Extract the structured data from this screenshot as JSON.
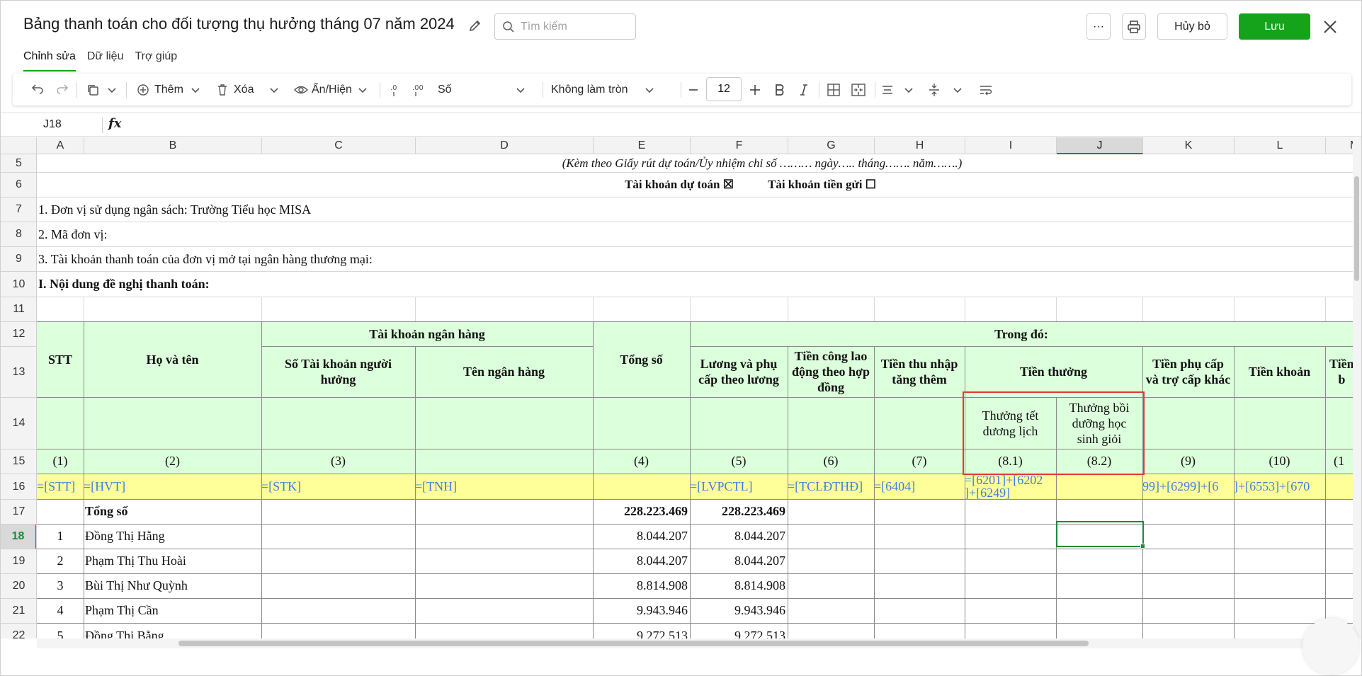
{
  "header": {
    "title": "Bảng thanh toán cho đối tượng thụ hưởng tháng 07 năm 2024",
    "search_placeholder": "Tìm kiếm",
    "more_label": "···",
    "cancel_label": "Hủy bỏ",
    "save_label": "Lưu"
  },
  "colors": {
    "accent": "#15a31c",
    "header_fill": "#dcffdc",
    "formula_row": "#ffff99",
    "formula_text": "#3f7fe0",
    "highlight": "#e53935"
  },
  "menu_tabs": [
    {
      "label": "Chỉnh sửa",
      "active": true
    },
    {
      "label": "Dữ liệu",
      "active": false
    },
    {
      "label": "Trợ giúp",
      "active": false
    }
  ],
  "toolbar": {
    "insert_label": "Thêm",
    "delete_label": "Xóa",
    "show_hide_label": "Ẩn/Hiện",
    "format_label": "Số",
    "rounding_label": "Không làm tròn",
    "font_size": "12"
  },
  "formula_bar": {
    "cell_ref": "J18",
    "fx": "fx"
  },
  "columns": [
    "A",
    "B",
    "C",
    "D",
    "E",
    "F",
    "G",
    "H",
    "I",
    "J",
    "K",
    "L",
    "M"
  ],
  "selected_column": "J",
  "rows": [
    "5",
    "6",
    "7",
    "8",
    "9",
    "10",
    "11",
    "12",
    "13",
    "14",
    "15",
    "16",
    "17",
    "18",
    "19",
    "20",
    "21",
    "22"
  ],
  "selected_row": "18",
  "sheet": {
    "r5": "(Kèm theo Giấy rút dự toán/Ủy nhiệm chi số ……… ngày….. tháng……. năm…….)",
    "r6a": "Tài khoản dự toán ☒",
    "r6b": "Tài khoản tiền gửi ☐",
    "r7": "1. Đơn vị sử dụng ngân sách: Trường Tiểu học MISA",
    "r8": "2. Mã đơn vị:",
    "r9": "3. Tài khoản thanh toán của đơn vị mở tại ngân hàng thương mại:",
    "r10": "I. Nội dung đề nghị thanh toán:",
    "hdr": {
      "stt": "STT",
      "ho_ten": "Họ và tên",
      "tk_ngan_hang": "Tài khoản ngân hàng",
      "so_tk": "Số Tài khoản người hưởng",
      "ten_ngan_hang": "Tên ngân hàng",
      "tong_so": "Tổng số",
      "trong_do": "Trong đó:",
      "luong": "Lương và phụ cấp theo lương",
      "tien_cong": "Tiền công lao động theo hợp đồng",
      "thu_nhap": "Tiền thu nhập tăng thêm",
      "tien_thuong": "Tiền thưởng",
      "phu_cap": "Tiền phụ cấp và trợ cấp khác",
      "tien_khoan": "Tiền khoản",
      "col_m": "Tiền b",
      "thuong_tet": "Thưởng tết dương lịch",
      "thuong_boi_duong": "Thưởng bồi dưỡng học sinh giỏi"
    },
    "idx": [
      "(1)",
      "(2)",
      "(3)",
      "",
      "(4)",
      "(5)",
      "(6)",
      "(7)",
      "(8.1)",
      "(8.2)",
      "(9)",
      "(10)",
      "(1"
    ],
    "formulas": {
      "a": "=[STT]",
      "b": "=[HVT]",
      "c": "=[STK]",
      "d": "=[TNH]",
      "f": "=[LVPCTL]",
      "g": "=[TCLĐTHĐ]",
      "h": "=[6404]",
      "i1": "=[6201]+[6202",
      "i2": "]+[6249]",
      "k": "99]+[6299]+[6",
      "l": "]+[6553]+[670"
    },
    "total_label": "Tổng số",
    "total_e": "228.223.469",
    "total_f": "228.223.469",
    "data_rows": [
      {
        "stt": "1",
        "name": "Đồng Thị Hằng",
        "e": "8.044.207",
        "f": "8.044.207"
      },
      {
        "stt": "2",
        "name": "Phạm Thị Thu Hoài",
        "e": "8.044.207",
        "f": "8.044.207"
      },
      {
        "stt": "3",
        "name": "Bùi Thị Như Quỳnh",
        "e": "8.814.908",
        "f": "8.814.908"
      },
      {
        "stt": "4",
        "name": "Phạm Thị Cần",
        "e": "9.943.946",
        "f": "9.943.946"
      },
      {
        "stt": "5",
        "name": "Đồng Thị Bằng",
        "e": "9.272.513",
        "f": "9.272.513"
      }
    ]
  }
}
